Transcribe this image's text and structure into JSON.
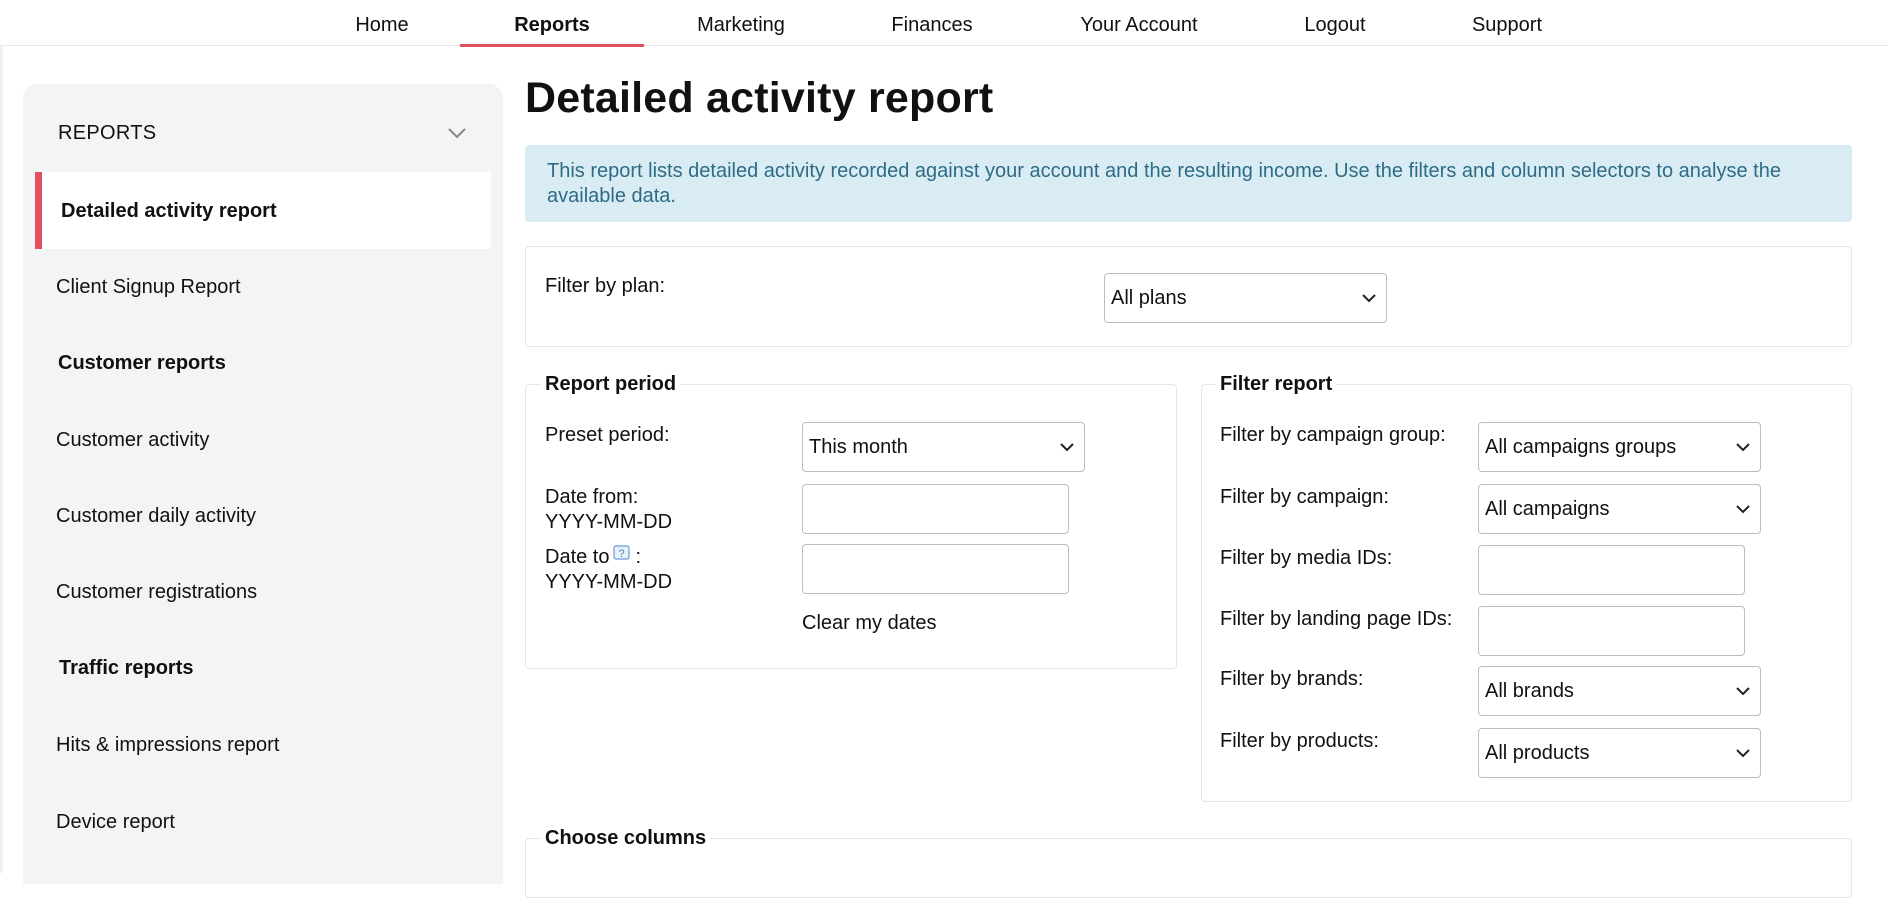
{
  "nav": {
    "items": [
      {
        "label": "Home"
      },
      {
        "label": "Reports"
      },
      {
        "label": "Marketing"
      },
      {
        "label": "Finances"
      },
      {
        "label": "Your Account"
      },
      {
        "label": "Logout"
      },
      {
        "label": "Support"
      }
    ],
    "active": "Reports"
  },
  "sidebar": {
    "header": "REPORTS",
    "active_item": "Detailed activity report",
    "items": [
      {
        "label": "Client Signup Report"
      },
      {
        "group": "Customer reports"
      },
      {
        "label": "Customer activity"
      },
      {
        "label": "Customer daily activity"
      },
      {
        "label": "Customer registrations"
      },
      {
        "group": "Traffic reports"
      },
      {
        "label": "Hits & impressions report"
      },
      {
        "label": "Device report"
      }
    ],
    "accent_color": "#e0525f"
  },
  "page": {
    "title": "Detailed activity report",
    "info": "This report lists detailed activity recorded against your account and the resulting income. Use the filters and column selectors to analyse the available data."
  },
  "plan_filter": {
    "label": "Filter by plan:",
    "value": "All plans"
  },
  "report_period": {
    "legend": "Report period",
    "preset_label": "Preset period:",
    "preset_value": "This month",
    "date_from_label": "Date from:",
    "date_from_format": "YYYY-MM-DD",
    "date_to_label": "Date to",
    "date_to_suffix": ":",
    "date_to_format": "YYYY-MM-DD",
    "date_from_value": "",
    "date_to_value": "",
    "clear_link": "Clear my dates"
  },
  "filter_report": {
    "legend": "Filter report",
    "campaign_group_label": "Filter by campaign group:",
    "campaign_group_value": "All campaigns groups",
    "campaign_label": "Filter by campaign:",
    "campaign_value": "All campaigns",
    "media_label": "Filter by media IDs:",
    "media_value": "",
    "landing_label": "Filter by landing page IDs:",
    "landing_value": "",
    "brands_label": "Filter by brands:",
    "brands_value": "All brands",
    "products_label": "Filter by products:",
    "products_value": "All products"
  },
  "columns": {
    "legend": "Choose columns"
  },
  "icons": {
    "sidebar_toggle": "chevron-down-icon",
    "select_arrow": "chevron-down-icon",
    "help": "help-icon"
  }
}
